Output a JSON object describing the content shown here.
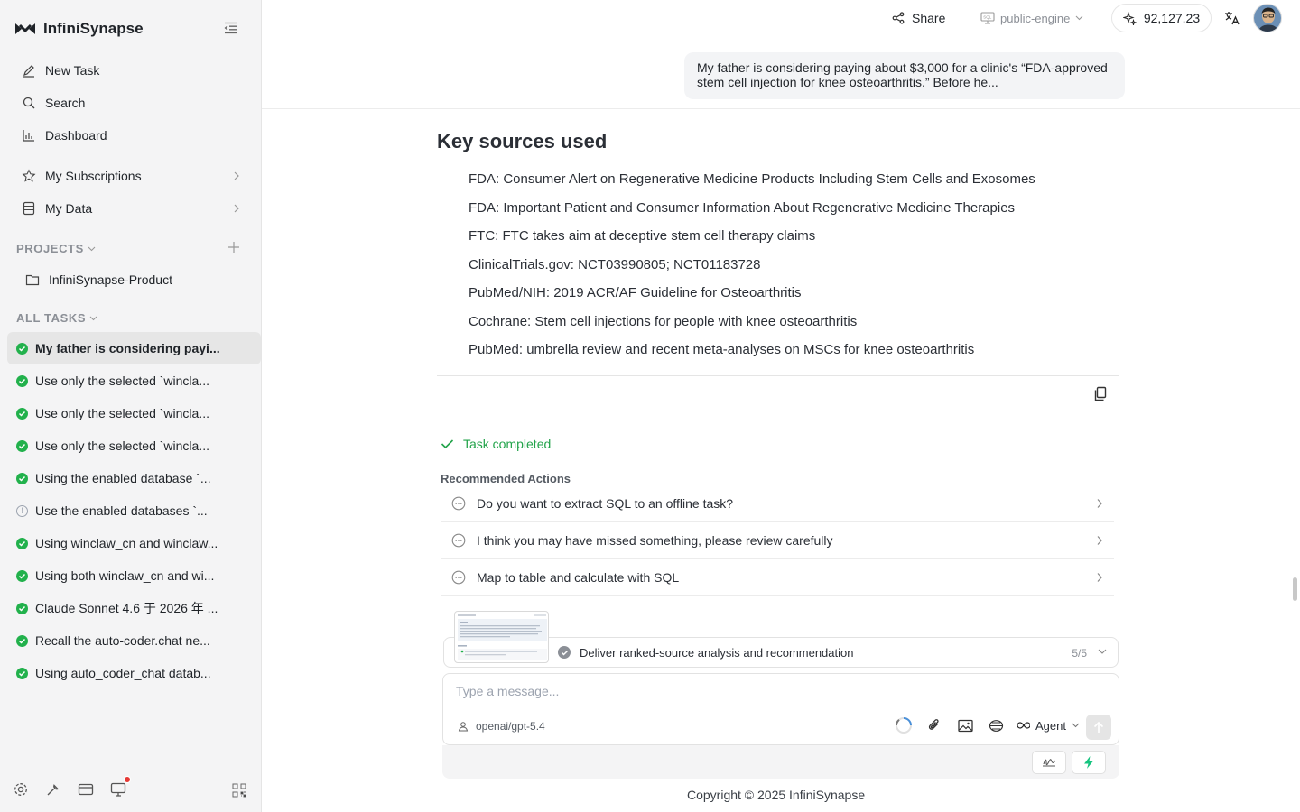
{
  "sidebar": {
    "brand": "InfiniSynapse",
    "nav": [
      {
        "label": "New Task",
        "icon": "pencil-icon"
      },
      {
        "label": "Search",
        "icon": "search-icon"
      },
      {
        "label": "Dashboard",
        "icon": "bar-chart-icon"
      },
      {
        "label": "My Subscriptions",
        "icon": "star-icon"
      },
      {
        "label": "My Data",
        "icon": "database-icon"
      }
    ],
    "projects_label": "PROJECTS",
    "projects": [
      {
        "label": "InfiniSynapse-Product",
        "icon": "folder-icon"
      }
    ],
    "tasks_label": "ALL TASKS",
    "tasks": [
      {
        "label": "My father is considering payi...",
        "status": "done"
      },
      {
        "label": "Use only the selected `wincla...",
        "status": "done"
      },
      {
        "label": "Use only the selected `wincla...",
        "status": "done"
      },
      {
        "label": "Use only the selected `wincla...",
        "status": "done"
      },
      {
        "label": "Using the enabled database `...",
        "status": "done"
      },
      {
        "label": "Use the enabled databases `...",
        "status": "info"
      },
      {
        "label": "Using winclaw_cn and winclaw...",
        "status": "done"
      },
      {
        "label": "Using both winclaw_cn and wi...",
        "status": "done"
      },
      {
        "label": "Claude Sonnet 4.6 于 2026 年 ...",
        "status": "done"
      },
      {
        "label": "Recall the auto-coder.chat ne...",
        "status": "done"
      },
      {
        "label": "Using auto_coder_chat datab...",
        "status": "done"
      }
    ],
    "bottom_icons": [
      "settings-icon",
      "wrench-icon",
      "credit-card-icon",
      "monitor-icon",
      "qr-code-icon"
    ]
  },
  "header": {
    "share_label": "Share",
    "engine_label": "public-engine",
    "credits": "92,127.23"
  },
  "conversation": {
    "user_message": "My father is considering paying about $3,000 for a clinic's “FDA-approved stem cell injection for knee osteoarthritis.” Before he..."
  },
  "main": {
    "sources_heading": "Key sources used",
    "sources": [
      "FDA: Consumer Alert on Regenerative Medicine Products Including Stem Cells and Exosomes",
      "FDA: Important Patient and Consumer Information About Regenerative Medicine Therapies",
      "FTC: FTC takes aim at deceptive stem cell therapy claims",
      "ClinicalTrials.gov: NCT03990805; NCT01183728",
      "PubMed/NIH: 2019 ACR/AF Guideline for Osteoarthritis",
      "Cochrane: Stem cell injections for people with knee osteoarthritis",
      "PubMed: umbrella review and recent meta-analyses on MSCs for knee osteoarthritis"
    ],
    "task_status": "Task completed",
    "recommended_title": "Recommended Actions",
    "recommended": [
      "Do you want to extract SQL to an offline task?",
      "I think you may have missed something, please review carefully",
      "Map to table and calculate with SQL"
    ]
  },
  "plan": {
    "step_label": "Deliver ranked-source analysis and recommendation",
    "progress": "5/5"
  },
  "composer": {
    "placeholder": "Type a message...",
    "model": "openai/gpt-5.4",
    "mode": "Agent"
  },
  "footer": {
    "copyright": "Copyright © 2025 InfiniSynapse"
  },
  "colors": {
    "success": "#22b14c",
    "sidebar_bg": "#f4f4f5",
    "accent_green": "#16c47f"
  }
}
